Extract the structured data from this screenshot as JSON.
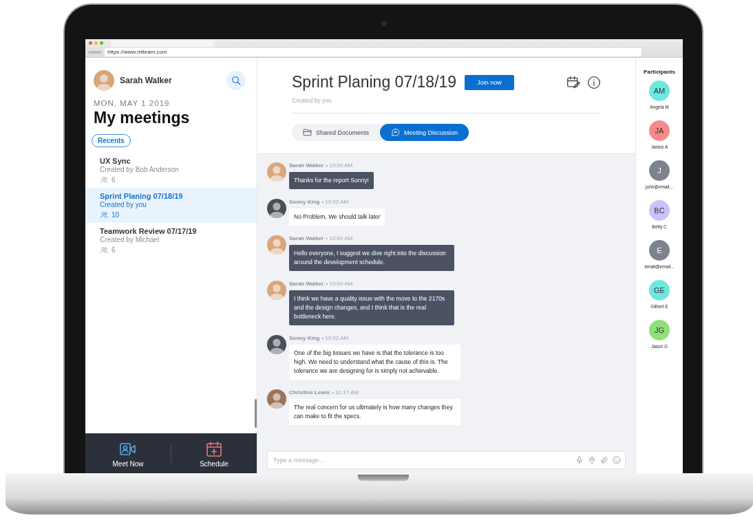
{
  "browser": {
    "url": "https://www.miteam.com"
  },
  "user": {
    "name": "Sarah Walker"
  },
  "date": "MON, MAY 1 2019",
  "heading": "My meetings",
  "filter": {
    "label": "Recents"
  },
  "meetings": [
    {
      "title": "UX Sync",
      "creator": "Created by Bob Anderson",
      "count": "6",
      "selected": false
    },
    {
      "title": "Sprint Planing 07/18/19",
      "creator": "Created by you",
      "count": "10",
      "selected": true
    },
    {
      "title": "Teamwork Review 07/17/19",
      "creator": "Created by Michael",
      "count": "6",
      "selected": false
    }
  ],
  "bottom_bar": [
    {
      "label": "Meet Now",
      "kind": "meet"
    },
    {
      "label": "Schedule",
      "kind": "schedule"
    }
  ],
  "meeting": {
    "title": "Sprint Planing 07/18/19",
    "join": "Join now",
    "subtitle": "Created by you"
  },
  "tabs": [
    {
      "label": "Shared Documents",
      "kind": "folder",
      "selected": false
    },
    {
      "label": "Meeting Discussion",
      "kind": "chat",
      "selected": true
    }
  ],
  "messages": [
    {
      "author": "Sarah Walker",
      "time": "• 10:00 AM",
      "text": "Thanks for the report Sonny!",
      "kind": "sent"
    },
    {
      "author": "Sonny King",
      "time": "• 10:02 AM",
      "text": "No Problem, We should talk later",
      "kind": "received"
    },
    {
      "author": "Sarah Walker",
      "time": "• 10:00 AM",
      "text": "Hello everyone, I suggest we dive right into the discussion around the development schedule.",
      "kind": "sent"
    },
    {
      "author": "Sarah Walker",
      "time": "• 10:00 AM",
      "text": "I think we have a quality issue with the move to the 2170s and the design changes, and I think that is the real bottleneck here.",
      "kind": "sent"
    },
    {
      "author": "Sonny King",
      "time": "• 10:02 AM",
      "text": "One of the big tissues we have is that the tolerance is too high. We need to understand what the cause of this is. The tolerance we are designing for is simply not achievable.",
      "kind": "received"
    },
    {
      "author": "Christine Lewis",
      "time": "• 10:17 AM",
      "text": "The real concern for us ultimately is how many changes they can make to fit the specs.",
      "kind": "received"
    }
  ],
  "composer": {
    "placeholder": "Type a message…"
  },
  "participants": {
    "title": "Participants",
    "people": [
      {
        "initials": "AM",
        "name": "Angela M",
        "color": "#6ee8de"
      },
      {
        "initials": "JA",
        "name": "Janice A",
        "color": "#f58a8a"
      },
      {
        "initials": "J",
        "name": "john@email...",
        "color": "#7c838f"
      },
      {
        "initials": "BC",
        "name": "Betty C",
        "color": "#c9c2fb"
      },
      {
        "initials": "E",
        "name": "email@email...",
        "color": "#7c838f"
      },
      {
        "initials": "GE",
        "name": "Gilbert E",
        "color": "#6ee8de"
      },
      {
        "initials": "JG",
        "name": "Jason G",
        "color": "#8fe07a"
      }
    ]
  }
}
